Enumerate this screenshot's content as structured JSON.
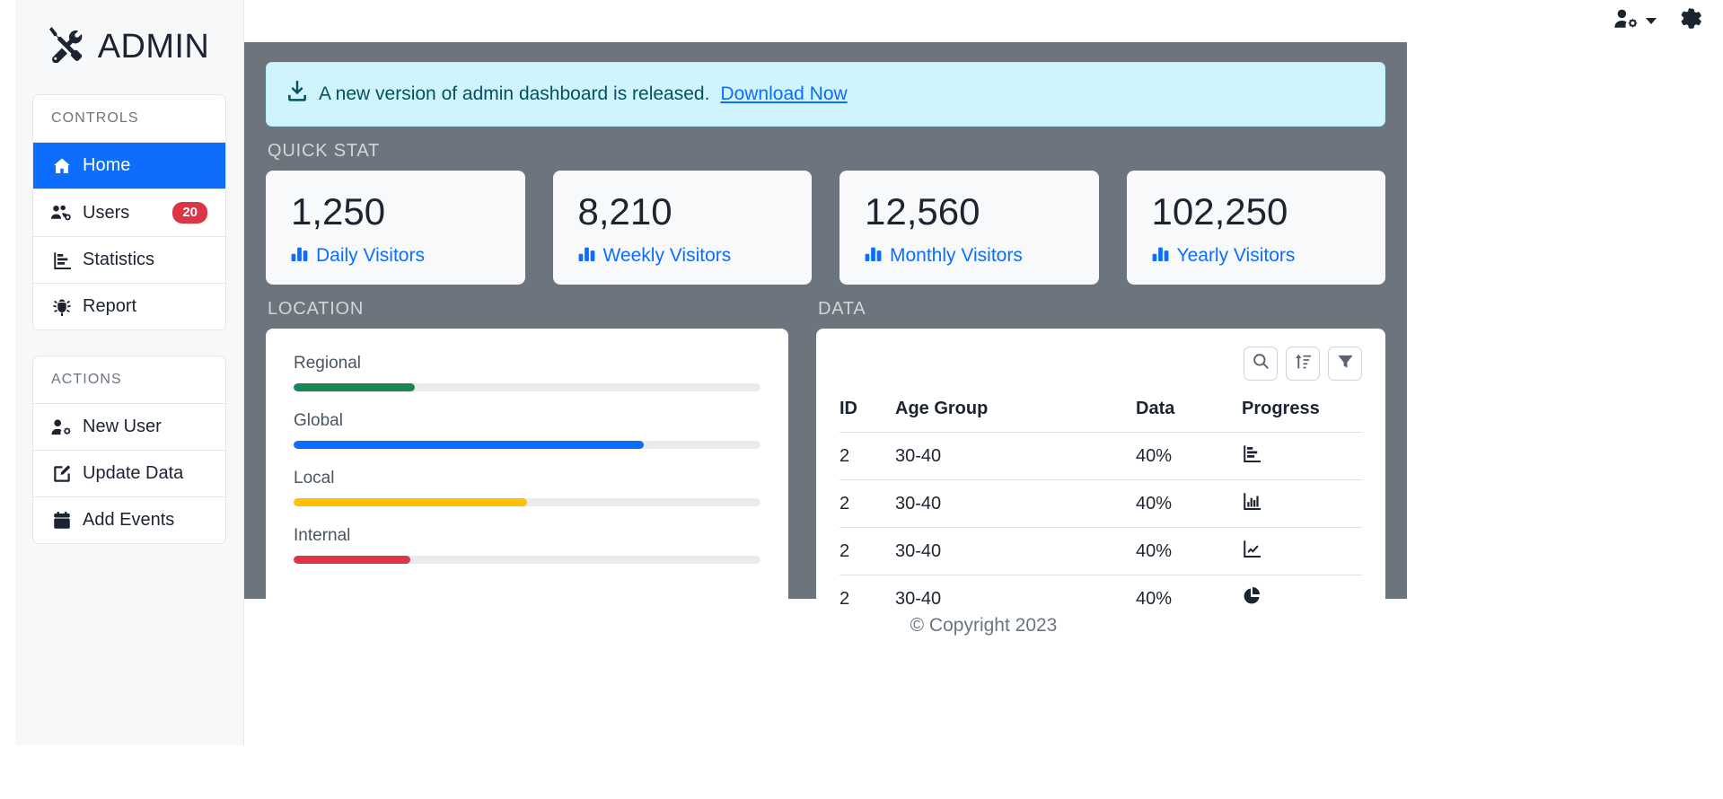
{
  "topbar": {
    "account_icon": "person-gear-icon",
    "dropdown_icon": "chevron-down-icon",
    "settings_icon": "gear-icon"
  },
  "sidebar": {
    "brand": {
      "logo_icon": "tools-icon",
      "text": "ADMIN"
    },
    "groups": [
      {
        "header": "CONTROLS",
        "items": [
          {
            "label": "Home",
            "icon": "house-fill-icon",
            "active": true,
            "badge": ""
          },
          {
            "label": "Users",
            "icon": "people-gear-icon",
            "active": false,
            "badge": "20"
          },
          {
            "label": "Statistics",
            "icon": "bar-chart-steps-icon",
            "active": false,
            "badge": ""
          },
          {
            "label": "Report",
            "icon": "bug-icon",
            "active": false,
            "badge": ""
          }
        ]
      },
      {
        "header": "ACTIONS",
        "items": [
          {
            "label": "New User",
            "icon": "person-gear-icon",
            "active": false,
            "badge": ""
          },
          {
            "label": "Update Data",
            "icon": "pencil-square-icon",
            "active": false,
            "badge": ""
          },
          {
            "label": "Add Events",
            "icon": "calendar-icon",
            "active": false,
            "badge": ""
          }
        ]
      }
    ]
  },
  "alert": {
    "icon": "download-icon",
    "message": "A new version of admin dashboard is released.",
    "link_text": "Download Now"
  },
  "quick_stat": {
    "title": "QUICK STAT",
    "cards": [
      {
        "value": "1,250",
        "label": "Daily Visitors",
        "icon": "bar-chart-fill-icon"
      },
      {
        "value": "8,210",
        "label": "Weekly Visitors",
        "icon": "bar-chart-fill-icon"
      },
      {
        "value": "12,560",
        "label": "Monthly Visitors",
        "icon": "bar-chart-fill-icon"
      },
      {
        "value": "102,250",
        "label": "Yearly Visitors",
        "icon": "bar-chart-fill-icon"
      }
    ]
  },
  "location": {
    "title": "LOCATION",
    "bars": [
      {
        "label": "Regional",
        "percent": 26,
        "color": "#198754"
      },
      {
        "label": "Global",
        "percent": 75,
        "color": "#0d6efd"
      },
      {
        "label": "Local",
        "percent": 50,
        "color": "#ffc107"
      },
      {
        "label": "Internal",
        "percent": 25,
        "color": "#dc3545"
      }
    ]
  },
  "data": {
    "title": "DATA",
    "toolbar": [
      {
        "name": "search-icon",
        "label": "Search"
      },
      {
        "name": "sort-up-icon",
        "label": "Sort"
      },
      {
        "name": "filter-icon",
        "label": "Filter"
      }
    ],
    "columns": [
      "ID",
      "Age Group",
      "Data",
      "Progress"
    ],
    "rows": [
      {
        "id": "2",
        "age_group": "30-40",
        "data": "40%",
        "progress_icon": "bar-chart-steps-icon"
      },
      {
        "id": "2",
        "age_group": "30-40",
        "data": "40%",
        "progress_icon": "bar-chart-icon"
      },
      {
        "id": "2",
        "age_group": "30-40",
        "data": "40%",
        "progress_icon": "graph-up-icon"
      },
      {
        "id": "2",
        "age_group": "30-40",
        "data": "40%",
        "progress_icon": "pie-chart-icon"
      }
    ]
  },
  "footer": {
    "text": "© Copyright 2023"
  },
  "colors": {
    "accent": "#0d6efd",
    "badge": "#dc3545",
    "main_bg": "#6c757d",
    "alert_bg": "#cff4fc"
  }
}
